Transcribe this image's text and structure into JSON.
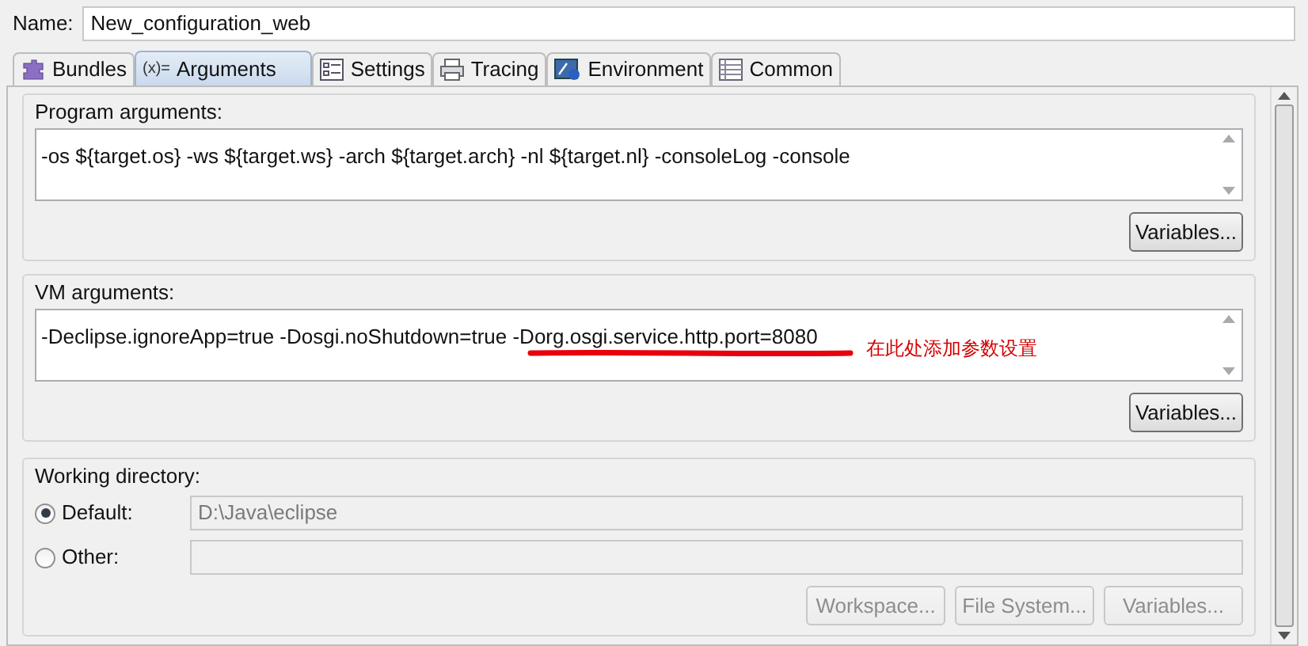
{
  "name_label": "Name:",
  "name_value": "New_configuration_web",
  "tabs": [
    {
      "label": "Bundles",
      "kind": "bundles",
      "selected": false
    },
    {
      "label": "Arguments",
      "kind": "arguments",
      "glyph": "(x)=",
      "selected": true
    },
    {
      "label": "Settings",
      "kind": "settings",
      "selected": false
    },
    {
      "label": "Tracing",
      "kind": "tracing",
      "selected": false
    },
    {
      "label": "Environment",
      "kind": "environment",
      "selected": false
    },
    {
      "label": "Common",
      "kind": "common",
      "selected": false
    }
  ],
  "program_arguments": {
    "title": "Program arguments:",
    "value": "-os ${target.os} -ws ${target.ws} -arch ${target.arch} -nl ${target.nl} -consoleLog -console",
    "button": "Variables..."
  },
  "vm_arguments": {
    "title": "VM arguments:",
    "value": "-Declipse.ignoreApp=true -Dosgi.noShutdown=true -Dorg.osgi.service.http.port=8080",
    "button": "Variables...",
    "annotation": "在此处添加参数设置"
  },
  "working_directory": {
    "title": "Working directory:",
    "options": [
      {
        "label": "Default:",
        "selected": true,
        "value": "D:\\Java\\eclipse"
      },
      {
        "label": "Other:",
        "selected": false
      }
    ],
    "buttons": [
      "Workspace...",
      "File System...",
      "Variables..."
    ]
  }
}
